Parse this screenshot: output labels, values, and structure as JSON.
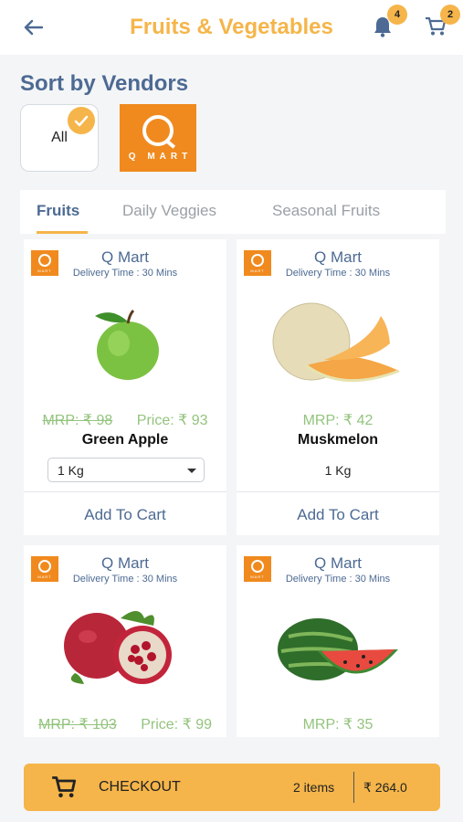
{
  "header": {
    "title": "Fruits & Vegetables",
    "notifications_count": "4",
    "cart_count": "2"
  },
  "sort": {
    "title": "Sort by Vendors",
    "vendors": [
      {
        "label": "All",
        "selected": true
      },
      {
        "label": "Q MART"
      }
    ]
  },
  "tabs": [
    {
      "label": "Fruits",
      "active": true
    },
    {
      "label": "Daily Veggies"
    },
    {
      "label": "Seasonal Fruits"
    }
  ],
  "products": [
    {
      "vendor": "Q Mart",
      "delivery": "Delivery Time : 30 Mins",
      "mrp": "MRP: ₹ 98",
      "price": "Price: ₹ 93",
      "name": "Green Apple",
      "qty": "1 Kg",
      "add_label": "Add To Cart"
    },
    {
      "vendor": "Q Mart",
      "delivery": "Delivery Time : 30 Mins",
      "mrp": "MRP: ₹ 42",
      "name": "Muskmelon",
      "qty": "1 Kg",
      "add_label": "Add To Cart"
    },
    {
      "vendor": "Q Mart",
      "delivery": "Delivery Time : 30 Mins",
      "mrp": "MRP: ₹ 103",
      "price": "Price: ₹ 99"
    },
    {
      "vendor": "Q Mart",
      "delivery": "Delivery Time : 30 Mins",
      "mrp": "MRP: ₹ 35"
    }
  ],
  "checkout": {
    "label": "CHECKOUT",
    "items": "2 items",
    "total": "₹ 264.0"
  },
  "colors": {
    "accent": "#f5b54a",
    "primary_text": "#4c6a93",
    "brand": "#f08a1e",
    "price_green": "#93c47d"
  }
}
